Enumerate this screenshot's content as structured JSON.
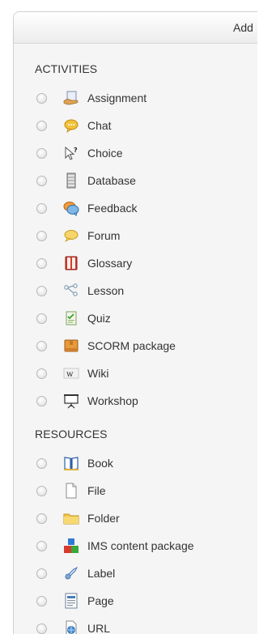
{
  "dialog": {
    "title": "Add"
  },
  "activities": {
    "heading": "ACTIVITIES",
    "items": [
      {
        "label": "Assignment",
        "icon": "assignment-icon"
      },
      {
        "label": "Chat",
        "icon": "chat-icon"
      },
      {
        "label": "Choice",
        "icon": "choice-icon"
      },
      {
        "label": "Database",
        "icon": "database-icon"
      },
      {
        "label": "Feedback",
        "icon": "feedback-icon"
      },
      {
        "label": "Forum",
        "icon": "forum-icon"
      },
      {
        "label": "Glossary",
        "icon": "glossary-icon"
      },
      {
        "label": "Lesson",
        "icon": "lesson-icon"
      },
      {
        "label": "Quiz",
        "icon": "quiz-icon"
      },
      {
        "label": "SCORM package",
        "icon": "scorm-icon"
      },
      {
        "label": "Wiki",
        "icon": "wiki-icon"
      },
      {
        "label": "Workshop",
        "icon": "workshop-icon"
      }
    ]
  },
  "resources": {
    "heading": "RESOURCES",
    "items": [
      {
        "label": "Book",
        "icon": "book-icon"
      },
      {
        "label": "File",
        "icon": "file-icon"
      },
      {
        "label": "Folder",
        "icon": "folder-icon"
      },
      {
        "label": "IMS content package",
        "icon": "ims-package-icon"
      },
      {
        "label": "Label",
        "icon": "label-icon"
      },
      {
        "label": "Page",
        "icon": "page-icon"
      },
      {
        "label": "URL",
        "icon": "url-icon"
      }
    ]
  }
}
